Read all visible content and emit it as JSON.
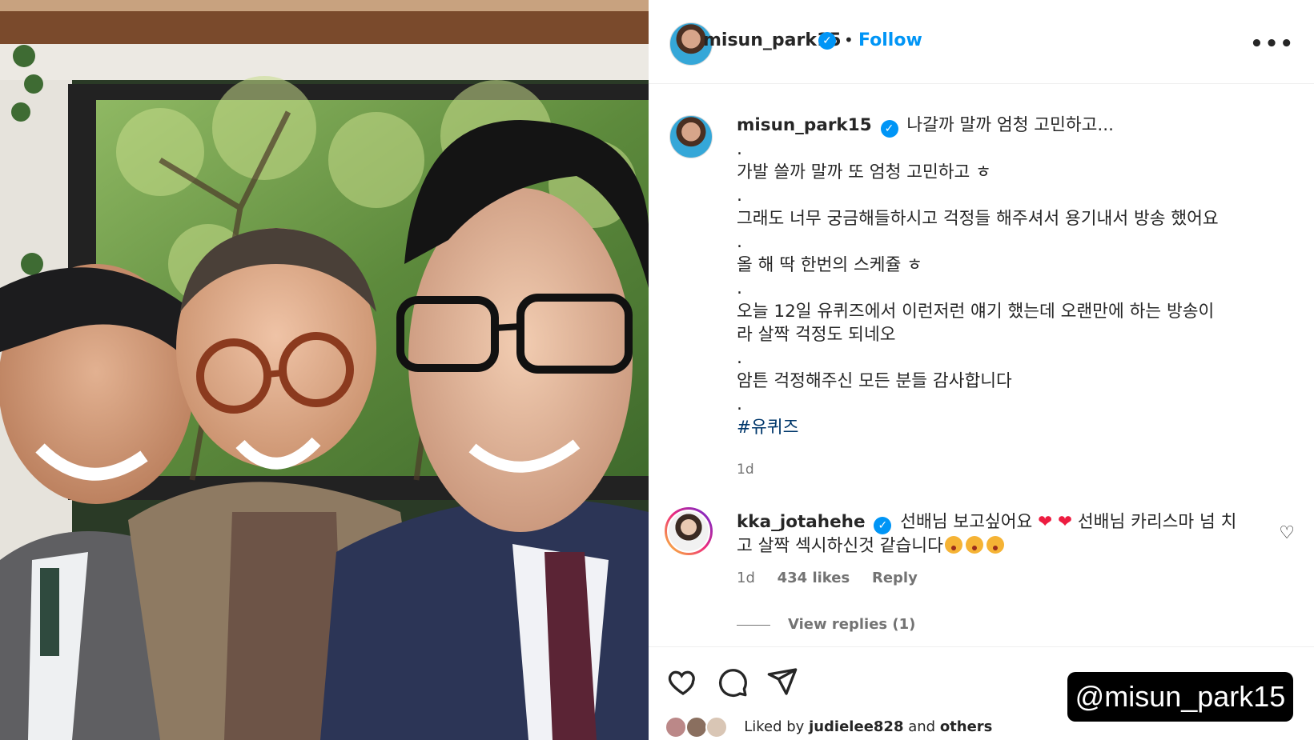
{
  "post": {
    "username": "misun_park15",
    "separator_dot": "•",
    "follow_label": "Follow",
    "more_label": "•••"
  },
  "caption": {
    "username": "misun_park15",
    "lines": [
      "나갈까 말까 엄청 고민하고...",
      ".",
      "가발 쓸까 말까 또 엄청 고민하고 ㅎ",
      ".",
      "그래도 너무 궁금해들하시고 걱정들 해주셔서 용기내서 방송 했어요",
      ".",
      "올 해 딱 한번의 스케쥴 ㅎ",
      ".",
      "오늘 12일 유퀴즈에서 이런저런 얘기 했는데 오랜만에 하는 방송이",
      "라 살짝 걱정도 되네오",
      ".",
      "암튼 걱정해주신 모든 분들 감사합니다",
      "."
    ],
    "hashtag": "#유퀴즈",
    "time": "1d"
  },
  "comment": {
    "username": "kka_jotahehe",
    "text_part1": "선배님 보고싶어요",
    "heart1": "❤",
    "heart2": "❤",
    "text_part2": "선배님 카리스마 넘",
    "text_part3": "치고 살짝 섹시하신것 같습니다",
    "time": "1d",
    "likes": "434 likes",
    "reply_label": "Reply",
    "view_replies": "View replies (1)"
  },
  "likes_bar": {
    "prefix": "Liked by",
    "user": "judielee828",
    "middle": "and",
    "suffix": "others"
  },
  "watermark": "@misun_park15",
  "colors": {
    "accent": "#0095f6",
    "hashtag": "#00376b",
    "muted": "#737373",
    "heart": "#ed1c40"
  },
  "icons": [
    "verified-badge-icon",
    "more-options-icon",
    "heart-icon",
    "comment-icon",
    "share-icon",
    "small-heart-icon"
  ]
}
